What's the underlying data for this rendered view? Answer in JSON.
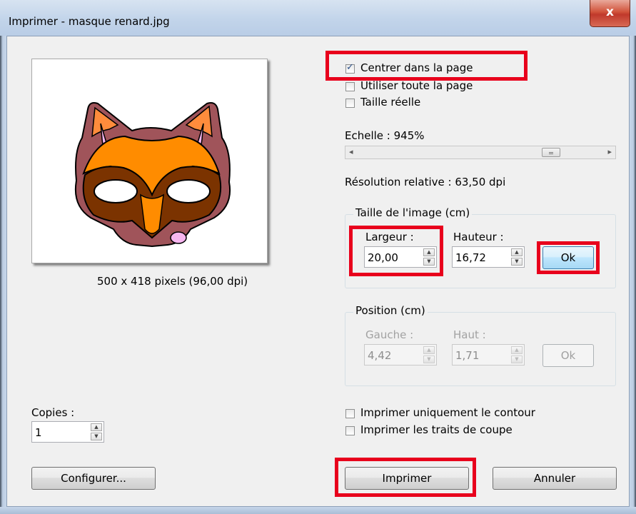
{
  "window": {
    "title": "Imprimer - masque renard.jpg",
    "close_glyph": "x"
  },
  "preview": {
    "image_info": "500 x 418 pixels (96,00 dpi)"
  },
  "options": {
    "center_label": "Centrer dans la page",
    "center_checked": true,
    "fullpage_label": "Utiliser toute la page",
    "fullpage_checked": false,
    "realsize_label": "Taille réelle",
    "realsize_checked": false
  },
  "scale": {
    "label": "Echelle : 945%",
    "left_arrow": "◂",
    "right_arrow": "▸"
  },
  "resolution_label": "Résolution relative : 63,50 dpi",
  "image_size": {
    "title": "Taille de l'image (cm)",
    "width_label": "Largeur :",
    "width_value": "20,00",
    "height_label": "Hauteur :",
    "height_value": "16,72",
    "ok_label": "Ok"
  },
  "position": {
    "title": "Position (cm)",
    "left_label": "Gauche :",
    "left_value": "4,42",
    "top_label": "Haut :",
    "top_value": "1,71",
    "ok_label": "Ok"
  },
  "copies": {
    "label": "Copies :",
    "value": "1"
  },
  "print_options": {
    "outline_label": "Imprimer uniquement le contour",
    "outline_checked": false,
    "cutmarks_label": "Imprimer les traits de coupe",
    "cutmarks_checked": false
  },
  "buttons": {
    "configure": "Configurer...",
    "print": "Imprimer",
    "cancel": "Annuler"
  },
  "colors": {
    "highlight": "#e8001c",
    "mask_orange": "#ff8c00",
    "mask_brown": "#7b3300",
    "mask_fur": "#a0545a",
    "ear_pink": "#f7b6f0"
  }
}
